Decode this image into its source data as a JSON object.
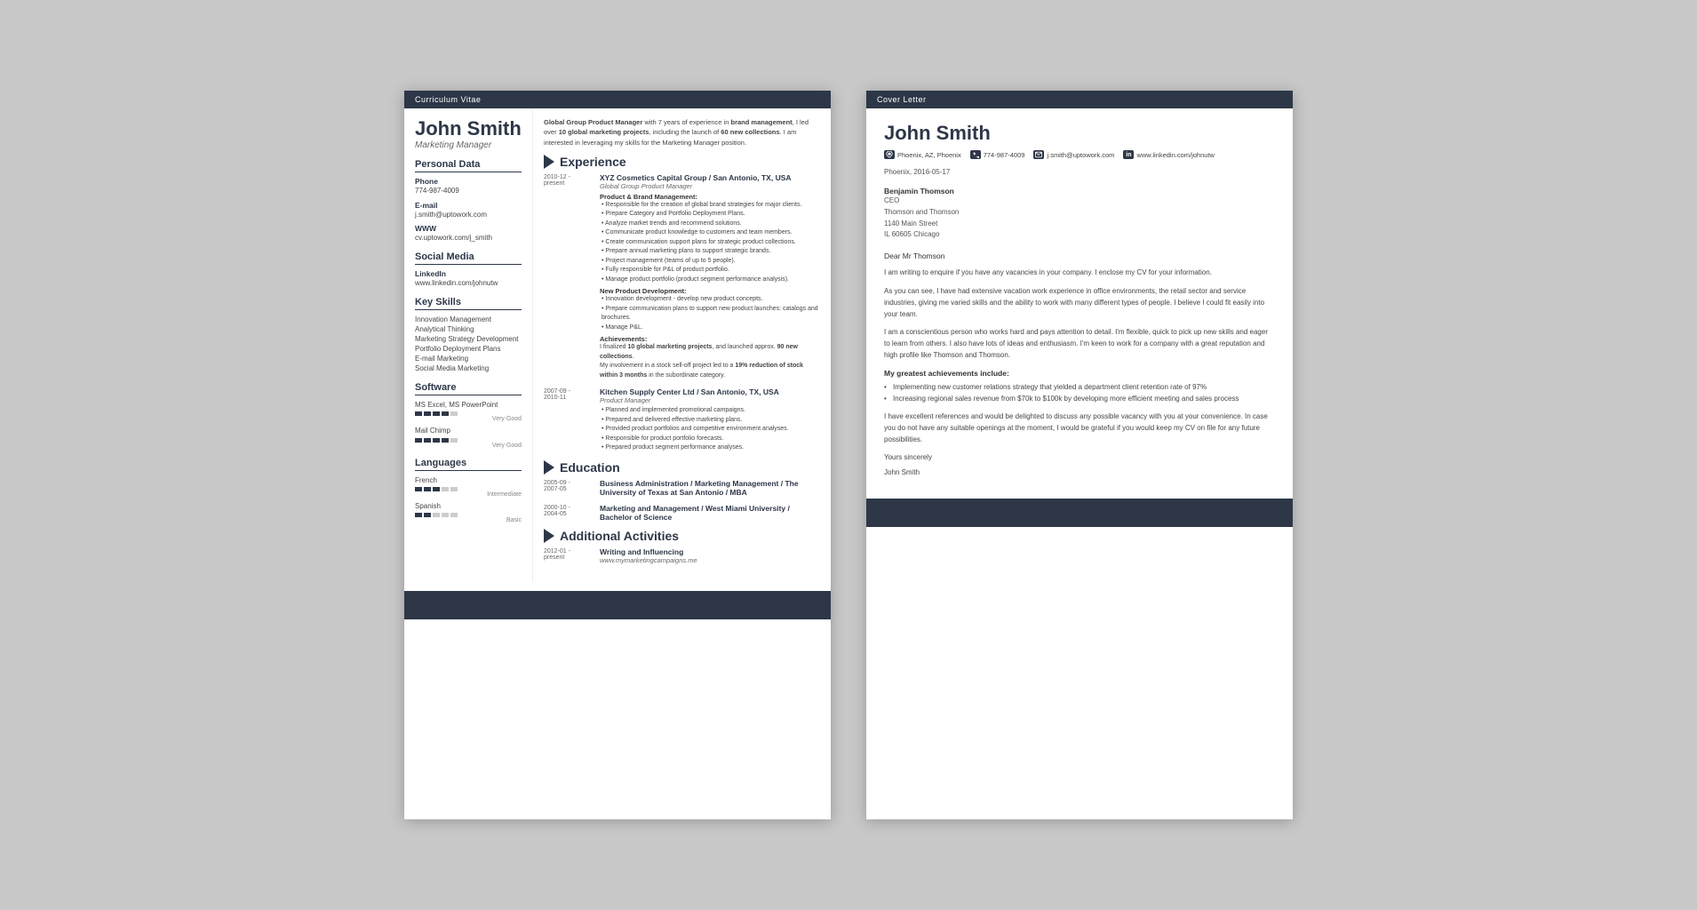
{
  "cv": {
    "header_label": "Curriculum Vitae",
    "name": "John Smith",
    "title": "Marketing Manager",
    "personal_data_section": "Personal Data",
    "phone_label": "Phone",
    "phone": "774-987-4009",
    "email_label": "E-mail",
    "email": "j.smith@uptowork.com",
    "www_label": "WWW",
    "www": "cv.uptowork.com/j_smith",
    "social_media_section": "Social Media",
    "linkedin_label": "LinkedIn",
    "linkedin": "www.linkedin.com/johnutw",
    "key_skills_section": "Key Skills",
    "skills": [
      "Innovation Management",
      "Analytical Thinking",
      "Marketing Strategy Development",
      "Portfolio Deployment Plans",
      "E-mail Marketing",
      "Social Media Marketing"
    ],
    "software_section": "Software",
    "software_name1": "MS Excel, MS PowerPoint",
    "software_level1": "Very Good",
    "software_dots1": [
      1,
      1,
      1,
      1,
      0
    ],
    "software_name2": "Mail Chimp",
    "software_level2": "Very Good",
    "software_dots2": [
      1,
      1,
      1,
      1,
      0
    ],
    "languages_section": "Languages",
    "lang1_name": "French",
    "lang1_level": "Intermediate",
    "lang1_dots": [
      1,
      1,
      1,
      0,
      0
    ],
    "lang2_name": "Spanish",
    "lang2_level": "Basic",
    "lang2_dots": [
      1,
      1,
      0,
      0,
      0
    ],
    "intro": "Global Group Product Manager with 7 years of experience in brand management, I led over 10 global marketing projects, including the launch of 60 new collections. I am interested in leveraging my skills for the Marketing Manager position.",
    "experience_section": "Experience",
    "experience_entries": [
      {
        "dates": "2010-12 - present",
        "company": "XYZ Cosmetics Capital Group / San Antonio, TX, USA",
        "role": "Global Group Product Manager",
        "subsections": [
          {
            "title": "Product & Brand Management:",
            "bullets": [
              "Responsible for the creation of global brand strategies for major clients.",
              "Prepare Category and Portfolio Deployment Plans.",
              "Analyze market trends and recommend solutions.",
              "Communicate product knowledge to customers and team members.",
              "Create communication support plans for strategic product collections.",
              "Prepare annual marketing plans to support strategic brands.",
              "Project management (teams of up to 5 people).",
              "Fully responsible for P&L of product portfolio.",
              "Manage product portfolio (product segment performance analysis)."
            ]
          },
          {
            "title": "New Product Development:",
            "bullets": [
              "Innovation development - develop new product concepts.",
              "Prepare communication plans to support new product launches: catalogs and brochures.",
              "Manage P&L."
            ]
          },
          {
            "title": "Achievements:",
            "achievements": [
              "I finalized 10 global marketing projects, and launched approx. 90 new collections.",
              "My involvement in a stock sell-off project led to a 19% reduction of stock within 3 months in the subordinate category."
            ]
          }
        ]
      },
      {
        "dates": "2007-09 - 2010-11",
        "company": "Kitchen Supply Center Ltd / San Antonio, TX, USA",
        "role": "Product Manager",
        "subsections": [
          {
            "title": "",
            "bullets": [
              "Planned and implemented promotional campaigns.",
              "Prepared and delivered effective marketing plans.",
              "Provided product portfolios and competitive environment analyses.",
              "Responsible for product portfolio forecasts.",
              "Prepared product segment performance analyses."
            ]
          }
        ]
      }
    ],
    "education_section": "Education",
    "education_entries": [
      {
        "dates": "2005-09 - 2007-05",
        "institution": "Business Administration / Marketing Management / The University of Texas at San Antonio / MBA"
      },
      {
        "dates": "2000-10 - 2004-05",
        "institution": "Marketing and Management / West Miami University / Bachelor of Science"
      }
    ],
    "activities_section": "Additional Activities",
    "activities_entries": [
      {
        "dates": "2012-01 - present",
        "title": "Writing and Influencing",
        "detail": "www.mymarketingcampaigns.me"
      }
    ]
  },
  "cl": {
    "header_label": "Cover Letter",
    "name": "John Smith",
    "contact_location": "Phoenix, AZ, Phoenix",
    "contact_phone": "774-987-4009",
    "contact_email": "j.smith@uptowork.com",
    "contact_linkedin": "www.linkedin.com/johnutw",
    "date": "Phoenix, 2016-05-17",
    "recipient_name": "Benjamin Thomson",
    "recipient_title": "CEO",
    "recipient_company": "Thomson and Thomson",
    "recipient_address": "1140 Main Street",
    "recipient_city": "IL 60605 Chicago",
    "salutation": "Dear Mr Thomson",
    "paragraph1": "I am writing to enquire if you have any vacancies in your company. I enclose my CV for your information.",
    "paragraph2": "As you can see, I have had extensive vacation work experience in office environments, the retail sector and service industries, giving me varied skills and the ability to work with many different types of people. I believe I could fit easily into your team.",
    "paragraph3": "I am a conscientious person who works hard and pays attention to detail. I'm flexible, quick to pick up new skills and eager to learn from others. I also have lots of ideas and enthusiasm. I'm keen to work for a company with a great reputation and high profile like Thomson and Thomson.",
    "achievements_title": "My greatest achievements include:",
    "achievement1": "Implementing new customer relations strategy that yielded a department client retention rate of 97%",
    "achievement2": "Increasing regional sales revenue from $70k to $100k by developing more efficient meeting and sales process",
    "paragraph4": "I have excellent references and would be delighted to discuss any possible vacancy with you at your convenience. In case you do not have any suitable openings at the moment, I would be grateful if you would keep my CV on file for any future possibilities.",
    "closing": "Yours sincerely",
    "signature": "John Smith"
  }
}
